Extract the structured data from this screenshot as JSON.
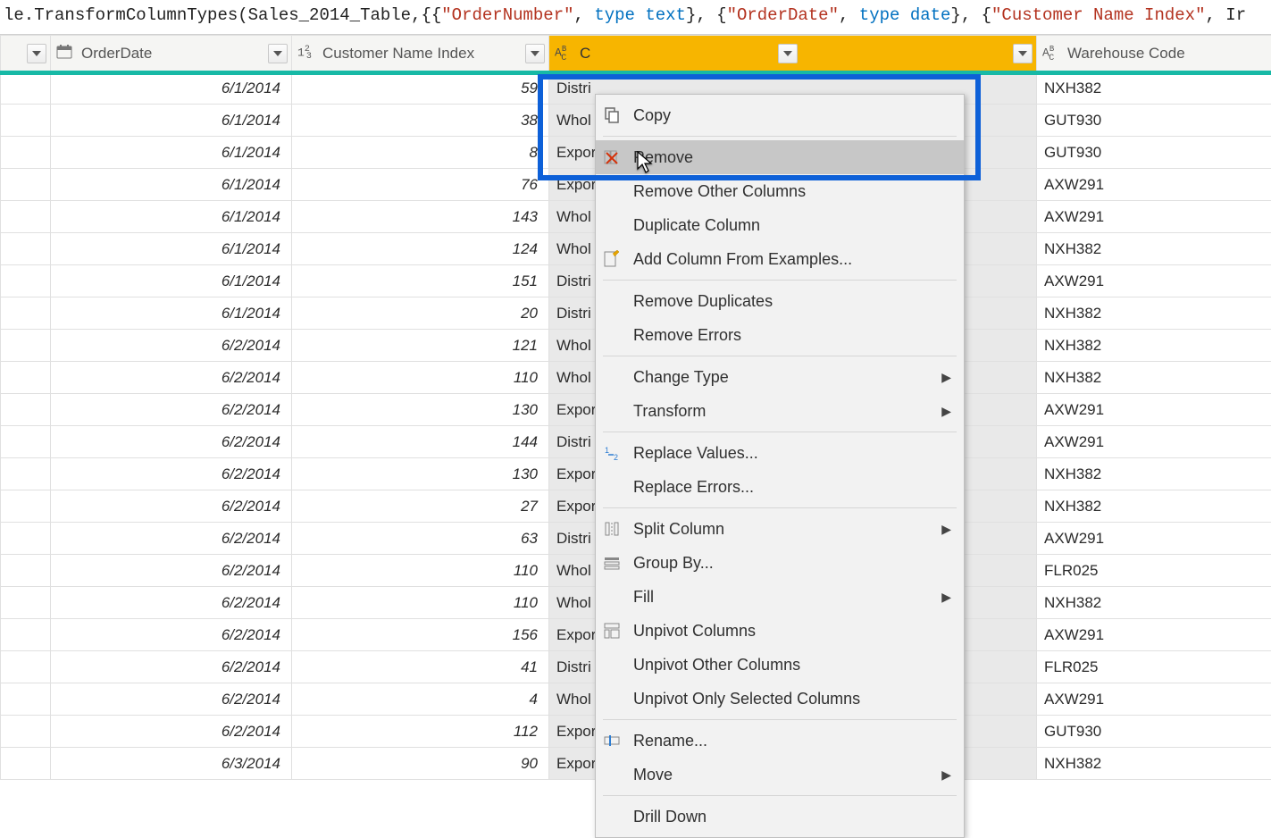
{
  "formula": {
    "prefix": "le.TransformColumnTypes(Sales_2014_Table,{{",
    "parts": [
      {
        "t": "str",
        "v": "\"OrderNumber\""
      },
      {
        "t": "p",
        "v": ", "
      },
      {
        "t": "kw",
        "v": "type"
      },
      {
        "t": "p",
        "v": " "
      },
      {
        "t": "kw",
        "v": "text"
      },
      {
        "t": "p",
        "v": "}, {"
      },
      {
        "t": "str",
        "v": "\"OrderDate\""
      },
      {
        "t": "p",
        "v": ", "
      },
      {
        "t": "kw",
        "v": "type"
      },
      {
        "t": "p",
        "v": " "
      },
      {
        "t": "kw",
        "v": "date"
      },
      {
        "t": "p",
        "v": "}, {"
      },
      {
        "t": "str",
        "v": "\"Customer Name Index\""
      },
      {
        "t": "p",
        "v": ", Ir"
      }
    ]
  },
  "columns": {
    "order_date": "OrderDate",
    "customer_index": "Customer Name Index",
    "channel_prefix": "C",
    "warehouse": "Warehouse Code"
  },
  "rows": [
    {
      "date": "6/1/2014",
      "idx": "59",
      "ch": "Distri",
      "wh": "NXH382"
    },
    {
      "date": "6/1/2014",
      "idx": "38",
      "ch": "Whol",
      "wh": "GUT930"
    },
    {
      "date": "6/1/2014",
      "idx": "8",
      "ch": "Expor",
      "wh": "GUT930"
    },
    {
      "date": "6/1/2014",
      "idx": "76",
      "ch": "Expor",
      "wh": "AXW291"
    },
    {
      "date": "6/1/2014",
      "idx": "143",
      "ch": "Whol",
      "wh": "AXW291"
    },
    {
      "date": "6/1/2014",
      "idx": "124",
      "ch": "Whol",
      "wh": "NXH382"
    },
    {
      "date": "6/1/2014",
      "idx": "151",
      "ch": "Distri",
      "wh": "AXW291"
    },
    {
      "date": "6/1/2014",
      "idx": "20",
      "ch": "Distri",
      "wh": "NXH382"
    },
    {
      "date": "6/2/2014",
      "idx": "121",
      "ch": "Whol",
      "wh": "NXH382"
    },
    {
      "date": "6/2/2014",
      "idx": "110",
      "ch": "Whol",
      "wh": "NXH382"
    },
    {
      "date": "6/2/2014",
      "idx": "130",
      "ch": "Expor",
      "wh": "AXW291"
    },
    {
      "date": "6/2/2014",
      "idx": "144",
      "ch": "Distri",
      "wh": "AXW291"
    },
    {
      "date": "6/2/2014",
      "idx": "130",
      "ch": "Expor",
      "wh": "NXH382"
    },
    {
      "date": "6/2/2014",
      "idx": "27",
      "ch": "Expor",
      "wh": "NXH382"
    },
    {
      "date": "6/2/2014",
      "idx": "63",
      "ch": "Distri",
      "wh": "AXW291"
    },
    {
      "date": "6/2/2014",
      "idx": "110",
      "ch": "Whol",
      "wh": "FLR025"
    },
    {
      "date": "6/2/2014",
      "idx": "110",
      "ch": "Whol",
      "wh": "NXH382"
    },
    {
      "date": "6/2/2014",
      "idx": "156",
      "ch": "Expor",
      "wh": "AXW291"
    },
    {
      "date": "6/2/2014",
      "idx": "41",
      "ch": "Distri",
      "wh": "FLR025"
    },
    {
      "date": "6/2/2014",
      "idx": "4",
      "ch": "Whol",
      "wh": "AXW291"
    },
    {
      "date": "6/2/2014",
      "idx": "112",
      "ch": "Expor",
      "wh": "GUT930"
    },
    {
      "date": "6/3/2014",
      "idx": "90",
      "ch": "Expor",
      "wh": "NXH382"
    }
  ],
  "menu": {
    "copy": "Copy",
    "remove": "Remove",
    "remove_other": "Remove Other Columns",
    "duplicate": "Duplicate Column",
    "add_examples": "Add Column From Examples...",
    "remove_dupes": "Remove Duplicates",
    "remove_errors": "Remove Errors",
    "change_type": "Change Type",
    "transform": "Transform",
    "replace_values": "Replace Values...",
    "replace_errors": "Replace Errors...",
    "split": "Split Column",
    "group_by": "Group By...",
    "fill": "Fill",
    "unpivot": "Unpivot Columns",
    "unpivot_other": "Unpivot Other Columns",
    "unpivot_sel": "Unpivot Only Selected Columns",
    "rename": "Rename...",
    "move": "Move",
    "drill": "Drill Down"
  }
}
